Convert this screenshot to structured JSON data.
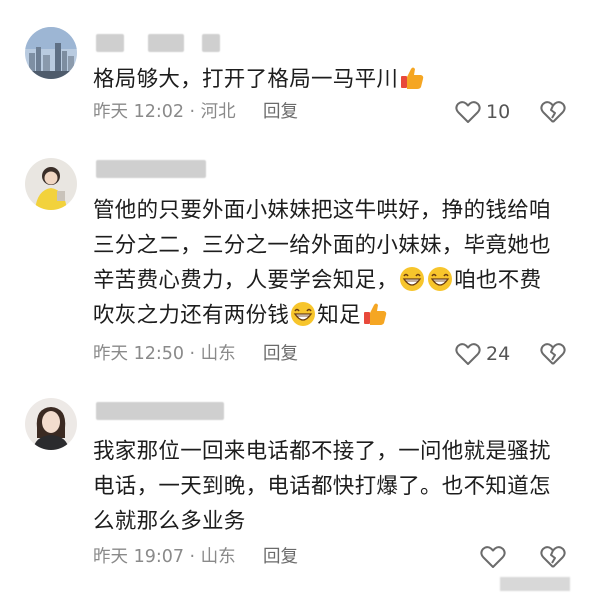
{
  "colors": {
    "text": "#1d1d1d",
    "meta": "#8a8a8a",
    "icon": "#6b6b6b",
    "thumb": "#f5a623",
    "thumb_cuff": "#e8493b",
    "grin": "#f7c52c"
  },
  "comments": [
    {
      "avatar": "avatar-city-skyline",
      "text_lines": [
        "格局够大，打开了格局一马平川"
      ],
      "trailing_emoji": "thumbs-up-icon",
      "time": "昨天 12:02 · 河北",
      "reply_label": "回复",
      "likes": "10"
    },
    {
      "avatar": "avatar-person-yellow",
      "text_lines": [
        "管他的只要外面小妹妹把这牛哄好，挣的钱给咱",
        "三分之二，三分之一给外面的小妹妹，毕竟她也",
        "辛苦费心费力，人要学会知足，",
        "咱也不费",
        "吹灰之力还有两份钱",
        "知足"
      ],
      "time": "昨天 12:50 · 山东",
      "reply_label": "回复",
      "likes": "24"
    },
    {
      "avatar": "avatar-woman-portrait",
      "text_lines": [
        "我家那位一回来电话都不接了，一问他就是骚扰",
        "电话，一天到晚，电话都快打爆了。也不知道怎",
        "么就那么多业务"
      ],
      "time": "昨天 19:07 · 山东",
      "reply_label": "回复",
      "likes": ""
    }
  ]
}
